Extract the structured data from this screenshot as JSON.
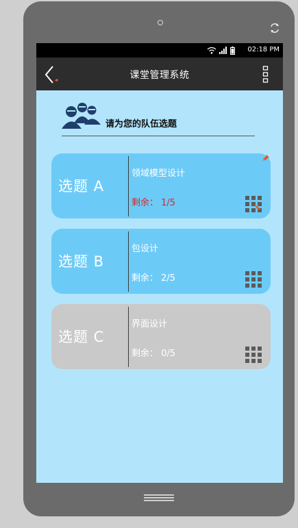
{
  "device": {
    "home_icon": "home-lines-icon",
    "rotate_icon": "rotate-icon"
  },
  "status_bar": {
    "time": "02:18 PM",
    "icons": [
      "wifi-icon",
      "signal-icon",
      "battery-icon"
    ]
  },
  "app_bar": {
    "title": "课堂管理系统",
    "back_icon": "back-arrow-icon",
    "menu_icon": "more-vertical-icon"
  },
  "header": {
    "text": "请为您的队伍选题",
    "icon": "team-icon"
  },
  "topics": [
    {
      "label": "选题 A",
      "name": "领域模型设计",
      "remain_label": "剩余：",
      "remain_value": "1/5",
      "state": "active",
      "warn": true
    },
    {
      "label": "选题 B",
      "name": "包设计",
      "remain_label": "剩余：",
      "remain_value": "2/5",
      "state": "active",
      "warn": false
    },
    {
      "label": "选题 C",
      "name": "界面设计",
      "remain_label": "剩余：",
      "remain_value": "0/5",
      "state": "disabled",
      "warn": false
    }
  ],
  "colors": {
    "screen_bg": "#b2e5fb",
    "card_active": "#6ccaf7",
    "card_disabled": "#c9c9c9",
    "warn_text": "#d42a2a",
    "app_bar": "#2d2d2d"
  }
}
